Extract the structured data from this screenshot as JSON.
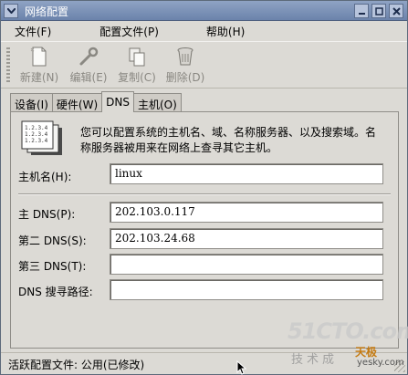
{
  "window": {
    "title": "网络配置"
  },
  "menubar": {
    "items": [
      "文件(F)",
      "配置文件(P)",
      "帮助(H)"
    ]
  },
  "toolbar": {
    "new": "新建(N)",
    "edit": "编辑(E)",
    "copy": "复制(C)",
    "delete": "删除(D)"
  },
  "tabs": [
    "设备(I)",
    "硬件(W)",
    "DNS",
    "主机(O)"
  ],
  "dns_panel": {
    "description": "您可以配置系统的主机名、域、名称服务器、以及搜索域。名称服务器被用来在网络上查寻其它主机。",
    "hostname_label": "主机名(H):",
    "hostname_value": "linux",
    "primary_label": "主 DNS(P):",
    "primary_value": "202.103.0.117",
    "secondary_label": "第二 DNS(S):",
    "secondary_value": "202.103.24.68",
    "tertiary_label": "第三 DNS(T):",
    "tertiary_value": "",
    "search_label": "DNS 搜寻路径:",
    "search_value": ""
  },
  "statusbar": {
    "text": "活跃配置文件: 公用(已修改)"
  },
  "watermark": {
    "brand": "51CTO.com",
    "tagline": "技术成",
    "brand2": "天极",
    "site": "yesky.com"
  },
  "icons": [
    "window-menu-icon",
    "minimize-icon",
    "maximize-icon",
    "close-icon",
    "new-icon",
    "edit-icon",
    "copy-icon",
    "delete-icon",
    "dns-info-icon",
    "mouse-cursor-icon"
  ]
}
